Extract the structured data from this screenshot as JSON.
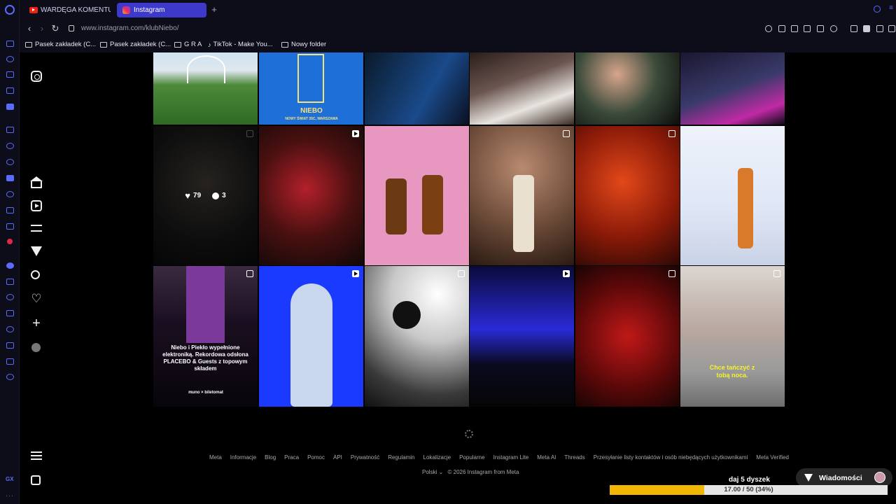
{
  "browser": {
    "tabs": [
      {
        "title": "WARDĘGA KOMENTUJE - ",
        "icon": "youtube-icon"
      },
      {
        "title": "Instagram",
        "icon": "instagram-icon",
        "active": true
      }
    ],
    "url": "www.instagram.com/klubNiebo/",
    "bookmarks": [
      {
        "label": "Pasek zakładek (C...",
        "icon": "folder-icon"
      },
      {
        "label": "Pasek zakładek (C...",
        "icon": "folder-icon"
      },
      {
        "label": "G R A",
        "icon": "folder-icon"
      },
      {
        "label": "TikTok - Make You...",
        "icon": "tiktok-icon"
      },
      {
        "label": "Nowy folder",
        "icon": "folder-icon"
      }
    ]
  },
  "instagram": {
    "nav": [
      "instagram-logo-icon",
      "home-icon",
      "reels-icon",
      "explore-filter-icon",
      "direct-send-icon",
      "search-icon",
      "notifications-heart-icon",
      "create-plus-icon",
      "profile-avatar",
      "more-menu-icon",
      "meta-apps-icon"
    ],
    "grid": {
      "hovered_post": {
        "likes": "79",
        "comments": "3"
      },
      "tile_texts": {
        "row0_col1": "NIEBO",
        "row0_col1_sub": "NOWY ŚWIAT 35C, WARSZAWA",
        "row2_col0_title": "Niebo i Piekło wypełnione elektroniką. Rekordowa odsłona PLACEBO & Guests z topowym składem",
        "row2_col0_logos": "muno × biletomat",
        "row2_col5_caption": "Chce tańczyć z tobą noca."
      }
    },
    "footer": {
      "links": [
        "Meta",
        "Informacje",
        "Blog",
        "Praca",
        "Pomoc",
        "API",
        "Prywatność",
        "Regulamin",
        "Lokalizacje",
        "Popularne",
        "Instagram Lite",
        "Meta AI",
        "Threads",
        "Przesyłanie listy kontaktów i osób niebędących użytkownikami",
        "Meta Verified"
      ],
      "language": "Polski",
      "copyright": "© 2026 Instagram from Meta"
    },
    "messages_label": "Wiadomości"
  },
  "stream_goal": {
    "label": "daj 5 dyszek",
    "progress_text": "17.00 / 50 (34%)",
    "progress_fraction": 0.34
  }
}
